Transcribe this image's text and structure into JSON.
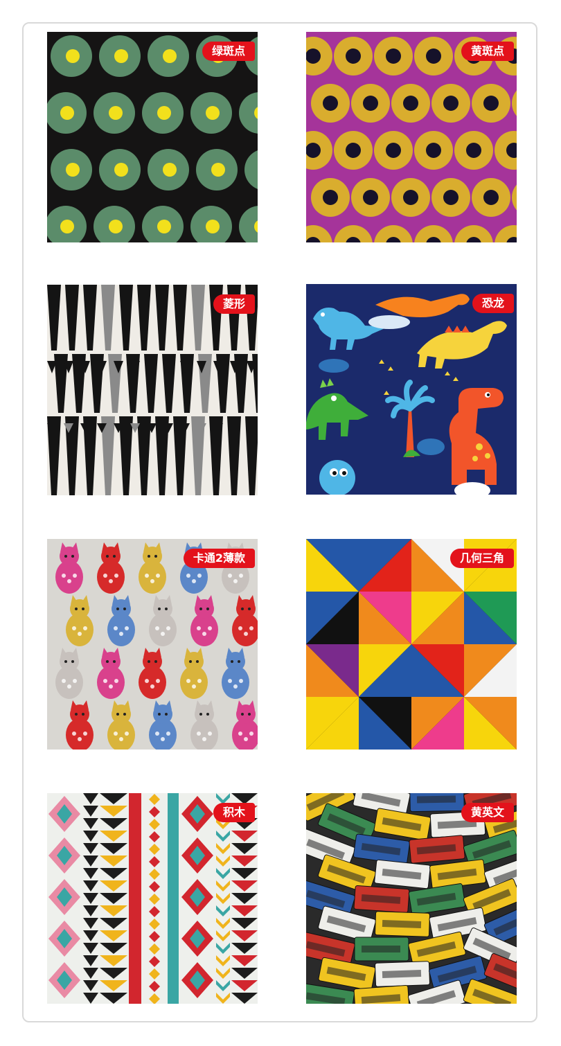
{
  "swatches": [
    {
      "label": "绿斑点",
      "pattern": "green-dots",
      "colors": {
        "bg": "#151414",
        "spot": "#5b8c6a",
        "center": "#f2e01c"
      }
    },
    {
      "label": "黄斑点",
      "pattern": "yellow-dots",
      "colors": {
        "bg": "#a5349a",
        "spot": "#d9ad2e",
        "center": "#16122a"
      }
    },
    {
      "label": "菱形",
      "pattern": "black-white-geometric",
      "colors": {
        "bg": "#efece6",
        "shape": "#141414",
        "accent": "#8a8a8a"
      }
    },
    {
      "label": "恐龙",
      "pattern": "dinosaurs",
      "colors": {
        "bg": "#1b2a6b",
        "orange": "#f2552a",
        "yellow": "#f6d33c",
        "green": "#3fae3a",
        "blue": "#4fb6e6"
      }
    },
    {
      "label": "卡通2薄款",
      "pattern": "cartoon-cats",
      "colors": {
        "bg": "#d9d7d2",
        "pink": "#d9418c",
        "red": "#d62a2a",
        "yellow": "#d9b43c",
        "blue": "#5b87c8"
      }
    },
    {
      "label": "几何三角",
      "pattern": "geometric-triangles",
      "colors": {
        "bg": "#111111",
        "red": "#e2231a",
        "yellow": "#f7d50c",
        "pink": "#ee3c8c",
        "green": "#1f9a55",
        "blue": "#2457a8",
        "white": "#f3f3f3"
      }
    },
    {
      "label": "积木",
      "pattern": "aztec-blocks",
      "colors": {
        "bg": "#eef0ec",
        "red": "#d2262e",
        "teal": "#3aa6a4",
        "yellow": "#f0b41c",
        "black": "#1c1c1c",
        "pink": "#e98aa4"
      }
    },
    {
      "label": "黄英文",
      "pattern": "license-plates",
      "colors": {
        "bg": "#2a2a2a",
        "yellow": "#f0c420",
        "white": "#eeeeea",
        "blue": "#2d5ca8",
        "red": "#c8342a",
        "green": "#3b8a52"
      }
    }
  ]
}
